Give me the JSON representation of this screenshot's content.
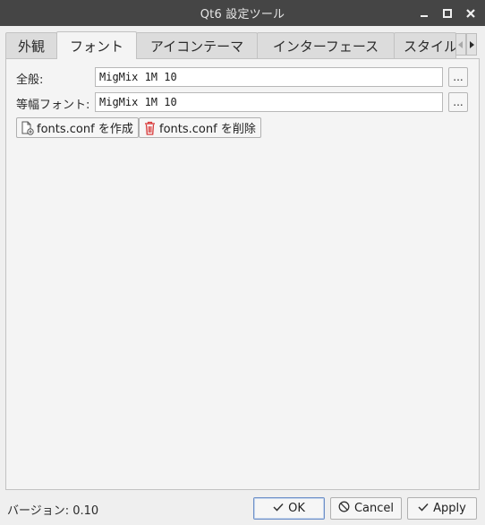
{
  "window": {
    "title": "Qt6 設定ツール"
  },
  "tabs": [
    {
      "label": "外観",
      "active": false
    },
    {
      "label": "フォント",
      "active": true
    },
    {
      "label": "アイコンテーマ",
      "active": false
    },
    {
      "label": "インターフェース",
      "active": false
    },
    {
      "label": "スタイル",
      "active": false
    }
  ],
  "fonts": {
    "general_label": "全般:",
    "general_value": "MigMix 1M 10",
    "fixed_label": "等幅フォント:",
    "fixed_value": "MigMix 1M 10",
    "choose_label": "..."
  },
  "actions": {
    "create_label": "fonts.conf を作成",
    "delete_label": "fonts.conf を削除"
  },
  "footer": {
    "version": "バージョン: 0.10",
    "ok_label": "OK",
    "cancel_label": "Cancel",
    "apply_label": "Apply"
  },
  "icons": {
    "minimize": "minimize-icon",
    "maximize": "maximize-icon",
    "close": "close-icon",
    "tab_left": "arrow-left-icon",
    "tab_right": "arrow-right-icon",
    "create": "new-document-icon",
    "delete": "trash-icon",
    "ok": "check-icon",
    "cancel": "cancel-icon",
    "apply": "check-icon"
  },
  "colors": {
    "titlebar": "#454545",
    "trash": "#d93b3b",
    "default_button_border": "#6d8fc7"
  }
}
